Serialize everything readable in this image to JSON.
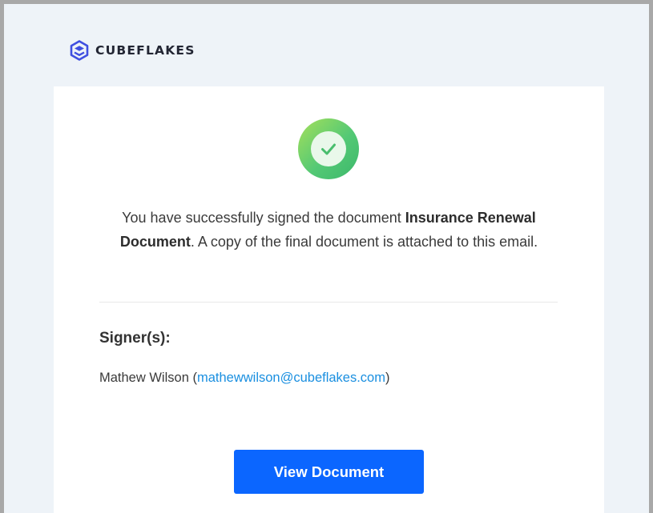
{
  "brand": {
    "name": "CUBEFLAKES",
    "logo_icon": "cubeflakes-logo-icon",
    "logo_color": "#3f4fe0"
  },
  "status": {
    "icon": "check-circle-icon",
    "color": "#54c975"
  },
  "message": {
    "prefix": "You have successfully signed the document ",
    "document_name": "Insurance Renewal Document",
    "suffix": ". A copy of the final document is attached to this email."
  },
  "signers": {
    "heading": "Signer(s):",
    "list": [
      {
        "name": "Mathew Wilson",
        "email": "mathewwilson@cubeflakes.com"
      }
    ]
  },
  "actions": {
    "view_document_label": "View Document",
    "button_color": "#0b66ff"
  }
}
